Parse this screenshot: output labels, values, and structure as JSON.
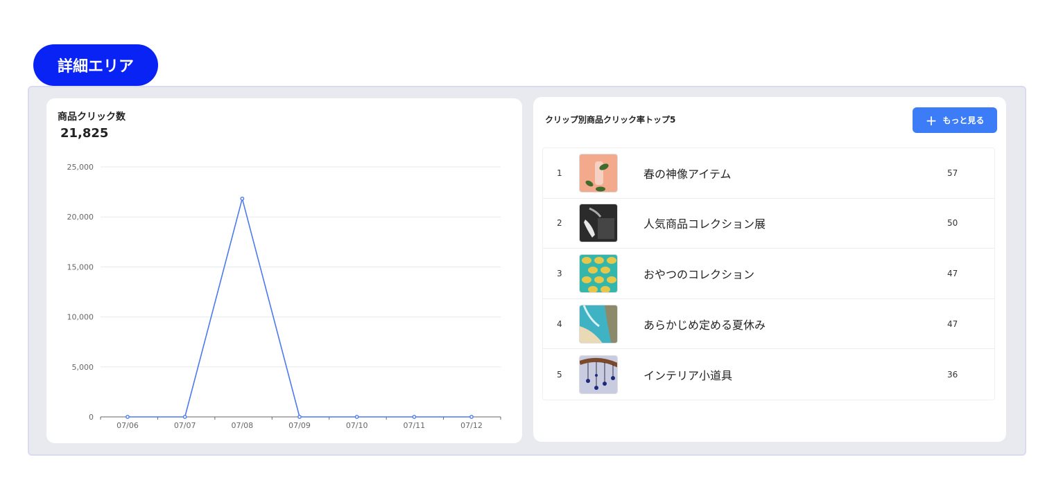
{
  "callout": {
    "label": "詳細エリア"
  },
  "metric": {
    "title": "商品クリック数",
    "value": "21,825"
  },
  "chart_data": {
    "type": "line",
    "categories": [
      "07/06",
      "07/07",
      "07/08",
      "07/09",
      "07/10",
      "07/11",
      "07/12"
    ],
    "series": [
      {
        "values": [
          0,
          0,
          21825,
          0,
          0,
          0,
          0
        ]
      }
    ],
    "ylim": [
      0,
      25000
    ],
    "yticks": [
      "0",
      "5,000",
      "10,000",
      "15,000",
      "20,000",
      "25,000"
    ],
    "ytick_values": [
      0,
      5000,
      10000,
      15000,
      20000,
      25000
    ],
    "grid": true,
    "color": "#4c78f0"
  },
  "ranking": {
    "title": "クリップ別商品クリック率トップ5",
    "more_label": "もっと見る",
    "items": [
      {
        "rank": "1",
        "name": "春の神像アイテム",
        "value": "57"
      },
      {
        "rank": "2",
        "name": "人気商品コレクション展",
        "value": "50"
      },
      {
        "rank": "3",
        "name": "おやつのコレクション",
        "value": "47"
      },
      {
        "rank": "4",
        "name": "あらかじめ定める夏休み",
        "value": "47"
      },
      {
        "rank": "5",
        "name": "インテリア小道具",
        "value": "36"
      }
    ]
  },
  "colors": {
    "accent": "#0a23f5",
    "button": "#3d7cf7",
    "line": "#4c78f0"
  }
}
